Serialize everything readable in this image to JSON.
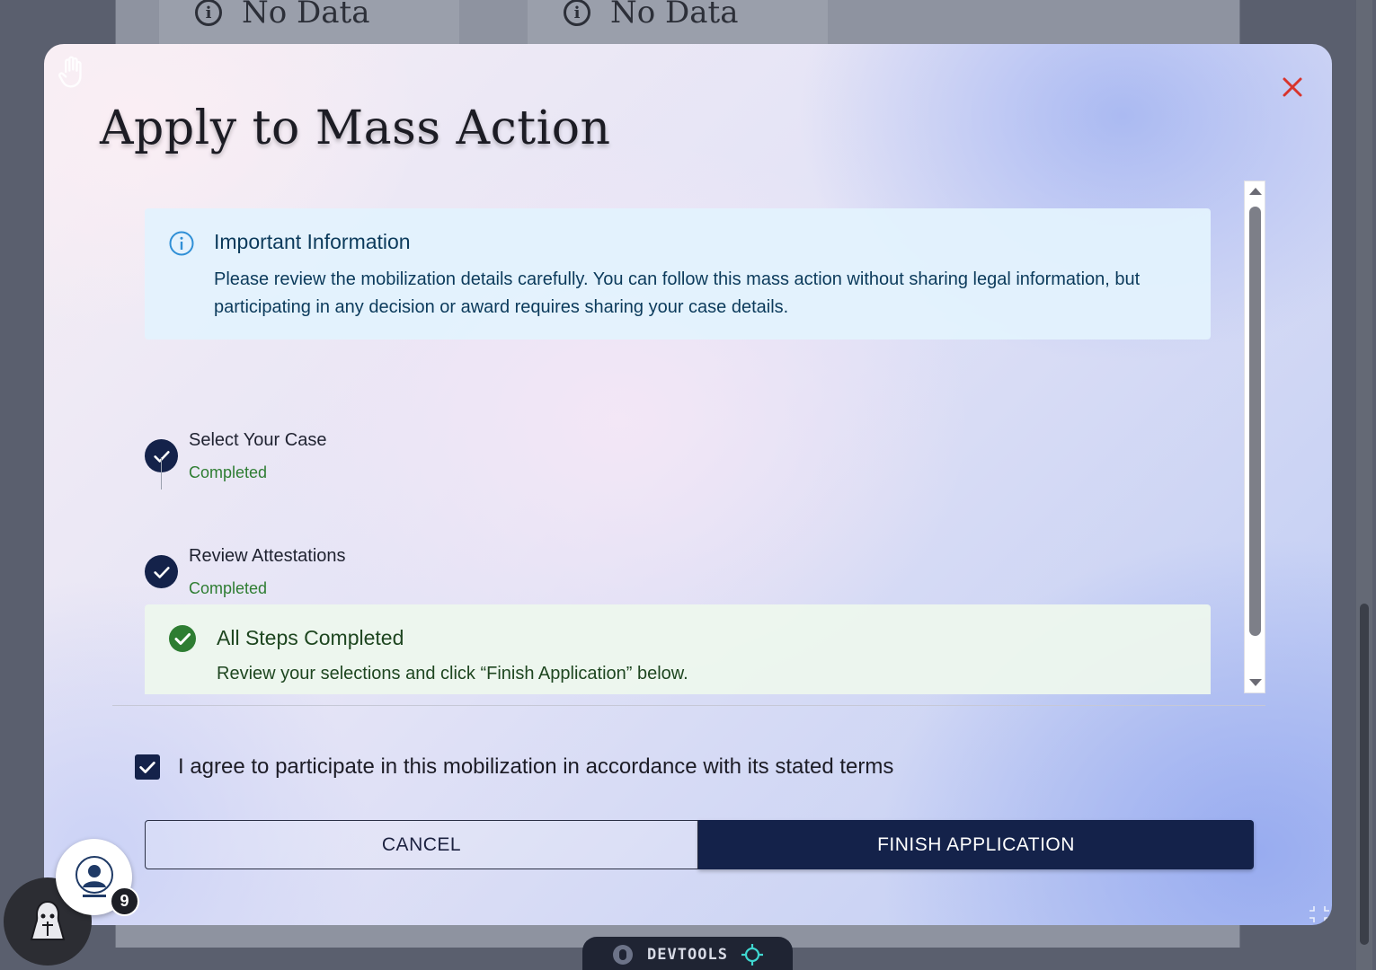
{
  "background": {
    "no_data_1": "No Data",
    "no_data_2": "No Data"
  },
  "modal": {
    "title": "Apply to Mass Action",
    "close_icon": "close-icon",
    "info_alert": {
      "title": "Important Information",
      "body": "Please review the mobilization details carefully. You can follow this mass action without sharing legal information, but participating in any decision or award requires sharing your case details."
    },
    "steps": [
      {
        "label": "Select Your Case",
        "status": "Completed"
      },
      {
        "label": "Review Attestations",
        "status": "Completed"
      }
    ],
    "success_alert": {
      "title": "All Steps Completed",
      "body": "Review your selections and click “Finish Application” below."
    },
    "agree": {
      "label": "I agree to participate in this mobilization in accordance with its stated terms",
      "checked": true
    },
    "buttons": {
      "cancel": "CANCEL",
      "finish": "FINISH APPLICATION"
    }
  },
  "widgets": {
    "notification_count": "9",
    "devtools_label": "DEVTOOLS"
  },
  "colors": {
    "primary": "#14224a",
    "close": "#d8342c",
    "success": "#2e7d32",
    "info": "#0b3a5b"
  }
}
